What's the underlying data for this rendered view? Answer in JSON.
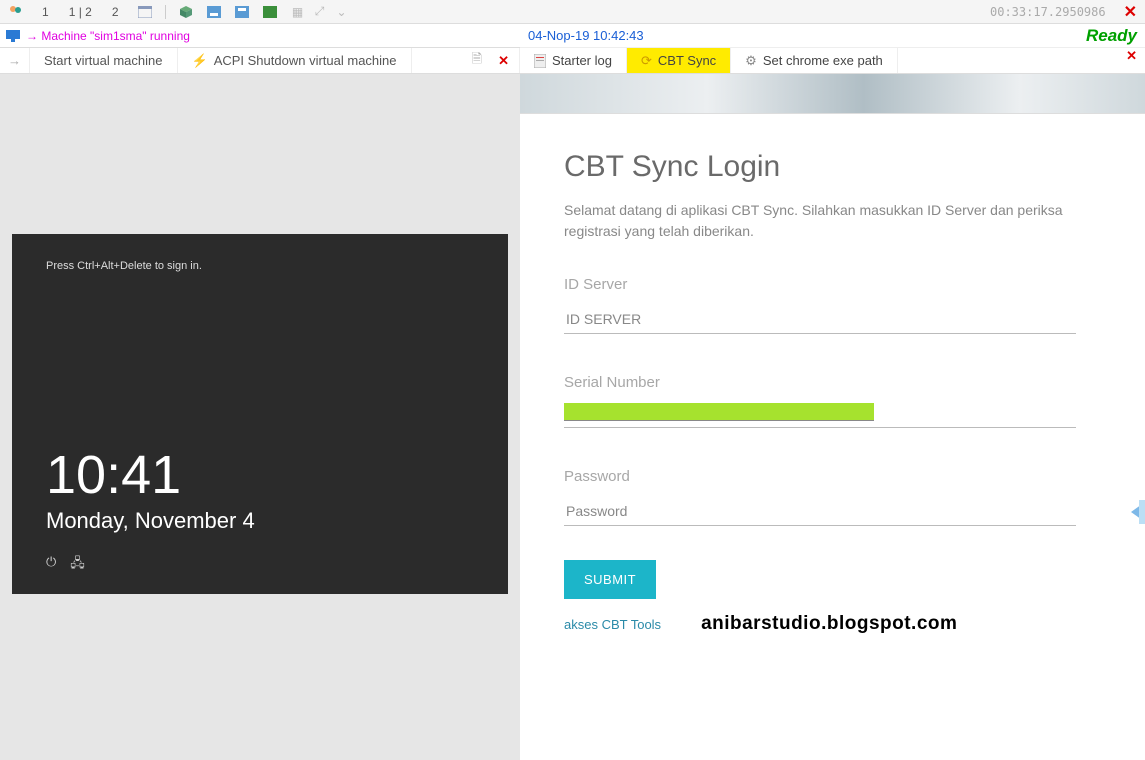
{
  "top_toolbar": {
    "nums": [
      "1",
      "1 | 2",
      "2"
    ],
    "timecode": "00:33:17.2950986"
  },
  "left": {
    "status_text": "→ Machine \"sim1sma\" running",
    "tab_start": "Start virtual machine",
    "tab_shutdown": "ACPI Shutdown virtual machine",
    "vm_hint": "Press Ctrl+Alt+Delete to sign in.",
    "vm_time": "10:41",
    "vm_date": "Monday, November 4"
  },
  "right": {
    "datetime": "04-Nop-19 10:42:43",
    "ready": "Ready",
    "tabs": {
      "starter": "Starter log",
      "cbt": "CBT Sync",
      "chrome": "Set chrome exe path"
    },
    "login": {
      "title": "CBT Sync Login",
      "desc": "Selamat datang di aplikasi CBT Sync. Silahkan masukkan ID Server dan periksa registrasi yang telah diberikan.",
      "id_label": "ID Server",
      "id_placeholder": "ID SERVER",
      "serial_label": "Serial Number",
      "password_label": "Password",
      "password_placeholder": "Password",
      "submit": "SUBMIT",
      "tools_link": "akses CBT Tools",
      "watermark": "anibarstudio.blogspot.com"
    }
  }
}
